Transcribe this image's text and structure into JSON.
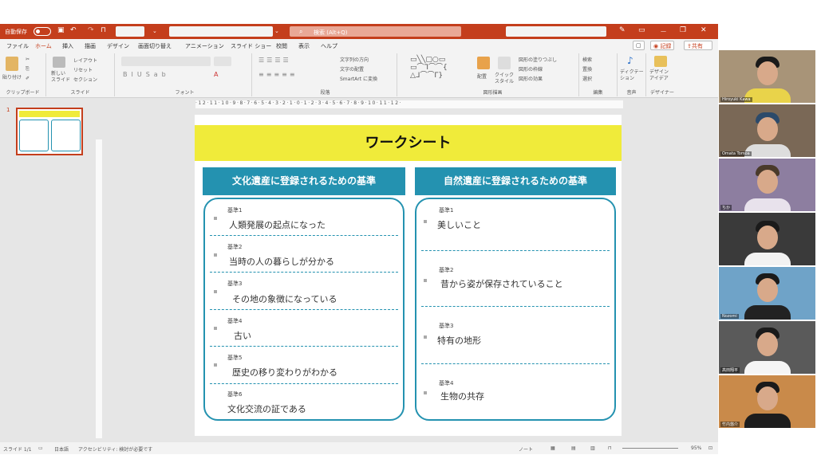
{
  "titlebar": {
    "autosave": "自動保存",
    "search": "検索 (Alt+Q)"
  },
  "menu": {
    "tabs": [
      "ファイル",
      "ホーム",
      "挿入",
      "描画",
      "デザイン",
      "画面切り替え",
      "アニメーション",
      "スライド ショー",
      "校閲",
      "表示",
      "ヘルプ"
    ],
    "record": "◉ 記録",
    "share": "共有"
  },
  "ribbon": {
    "clipboard": {
      "label": "クリップボード",
      "paste": "貼り付け"
    },
    "slides": {
      "label": "スライド",
      "new_slide": "新しい\nスライド",
      "layout": "レイアウト",
      "reset": "リセット",
      "section": "セクション"
    },
    "font": {
      "label": "フォント"
    },
    "paragraph": {
      "label": "段落",
      "text_direction": "文字列の方向",
      "align_text": "文字の配置",
      "smartart": "SmartArt に変換"
    },
    "drawing": {
      "label": "図形描画",
      "arrange": "配置",
      "quick_styles": "クイック\nスタイル",
      "fill": "図形の塗りつぶし",
      "outline": "図形の枠線",
      "effects": "図形の効果"
    },
    "editing": {
      "label": "編集",
      "find": "検索",
      "replace": "置換",
      "select": "選択"
    },
    "voice": {
      "label": "音声",
      "dictate": "ディクテー\nション"
    },
    "designer": {
      "label": "デザイナー",
      "ideas": "デザイン\nアイデア"
    }
  },
  "ruler": {
    "h": "·12·11·10·9·8·7·6·5·4·3·2·1·0·1·2·3·4·5·6·7·8·9·10·11·12·"
  },
  "thumb": {
    "number": "1"
  },
  "slide": {
    "title": "ワークシート",
    "left": {
      "header": "文化遺産に登録されるための基準",
      "items": [
        {
          "label": "基準1",
          "text": "人類発展の起点になった"
        },
        {
          "label": "基準2",
          "text": "当時の人の暮らしが分かる"
        },
        {
          "label": "基準3",
          "text": "その地の象徴になっている"
        },
        {
          "label": "基準4",
          "text": "古い"
        },
        {
          "label": "基準5",
          "text": "歴史の移り変わりがわかる"
        },
        {
          "label": "基準6",
          "text": "文化交流の証である"
        }
      ]
    },
    "right": {
      "header": "自然遺産に登録されるための基準",
      "items": [
        {
          "label": "基準1",
          "text": "美しいこと"
        },
        {
          "label": "基準2",
          "text": "昔から姿が保存されていること"
        },
        {
          "label": "基準3",
          "text": "特有の地形"
        },
        {
          "label": "基準4",
          "text": "生物の共存"
        }
      ]
    }
  },
  "status": {
    "slide": "スライド 1/1",
    "lang": "日本語",
    "accessibility": "アクセシビリティ: 検討が必要です",
    "notes": "ノート",
    "zoom": "95%"
  },
  "participants": [
    {
      "name": "Hiroyuki Kawa"
    },
    {
      "name": "Omata Tomoa"
    },
    {
      "name": "ちか"
    },
    {
      "name": ""
    },
    {
      "name": "Nozomi"
    },
    {
      "name": "高田翔平"
    },
    {
      "name": "竹内悠介"
    }
  ],
  "colors": {
    "accent": "#c43e1c",
    "teal": "#2492b0",
    "yellow": "#f0eb3a"
  }
}
